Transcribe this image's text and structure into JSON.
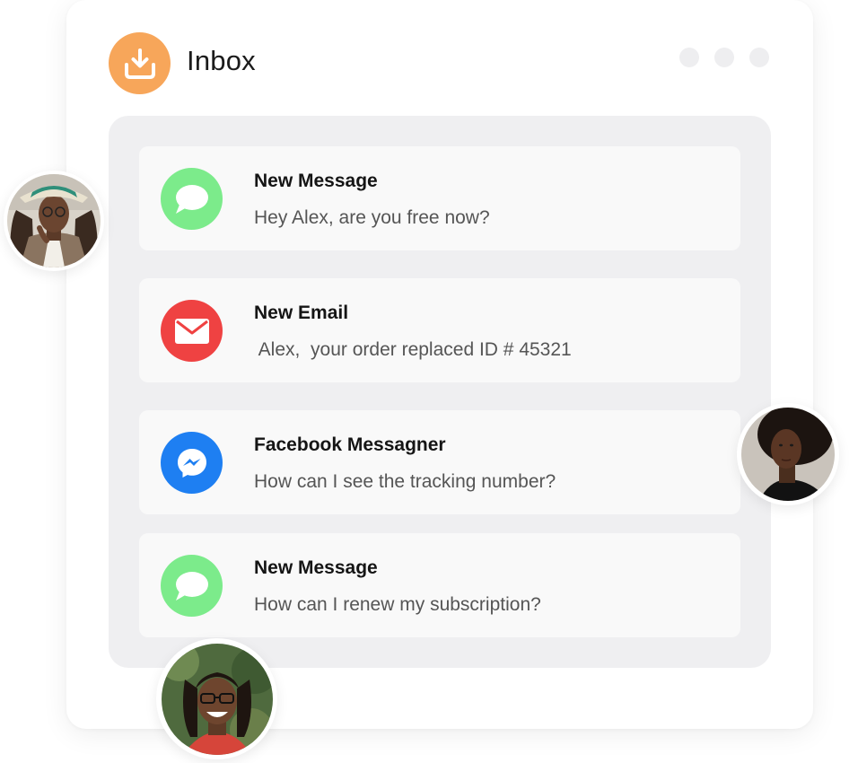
{
  "header": {
    "title": "Inbox",
    "icon": "inbox-download-icon",
    "icon_color": "#f7a65a"
  },
  "window_controls": [
    "dot",
    "dot",
    "dot"
  ],
  "items": [
    {
      "title": "New Message",
      "text": "Hey Alex, are you free now?",
      "icon": "chat-bubble-icon",
      "icon_color": "#7ceb8b"
    },
    {
      "title": "New Email",
      "text": " Alex,  your order replaced ID # 45321",
      "icon": "envelope-icon",
      "icon_color": "#ef4242"
    },
    {
      "title": "Facebook Messagner",
      "text": "How can I see the tracking number?",
      "icon": "messenger-icon",
      "icon_color": "#1e7ff2"
    },
    {
      "title": "New Message",
      "text": "How can I renew my subscription?",
      "icon": "chat-bubble-icon",
      "icon_color": "#7ceb8b"
    }
  ],
  "avatars": [
    {
      "icon": "avatar-photo"
    },
    {
      "icon": "avatar-photo"
    },
    {
      "icon": "avatar-photo"
    }
  ]
}
